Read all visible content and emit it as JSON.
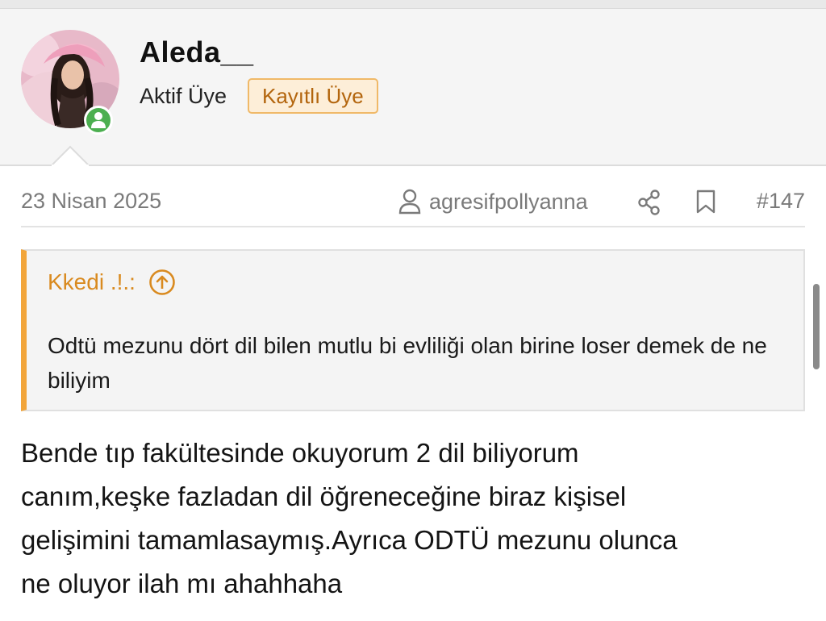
{
  "user": {
    "name": "Aleda__",
    "title": "Aktif Üye",
    "badge": "Kayıtlı Üye",
    "avatar_icon": "avatar-photo",
    "online_icon": "user-icon"
  },
  "post": {
    "date": "23 Nisan 2025",
    "author_link": "agresifpollyanna",
    "share_icon": "share-icon",
    "bookmark_icon": "bookmark-icon",
    "number": "#147",
    "quote": {
      "author": "Kkedi .!.:",
      "jump_icon": "arrow-up-circle-icon",
      "text": "Odtü mezunu dört dil bilen mutlu bi evliliği olan birine loser demek de ne biliyim"
    },
    "body": "Bende tıp fakültesinde okuyorum 2 dil biliyorum\ncanım,keşke fazladan dil öğreneceğine biraz kişisel\ngelişimini tamamlasaymış.Ayrıca ODTÜ mezunu olunca\nne oluyor ilah mı ahahhaha"
  },
  "colors": {
    "accent": "#f2a53a",
    "badge_text": "#b3650d",
    "badge_bg": "#fdeed8",
    "online": "#4caf50",
    "muted_text": "#7a7a7a"
  }
}
